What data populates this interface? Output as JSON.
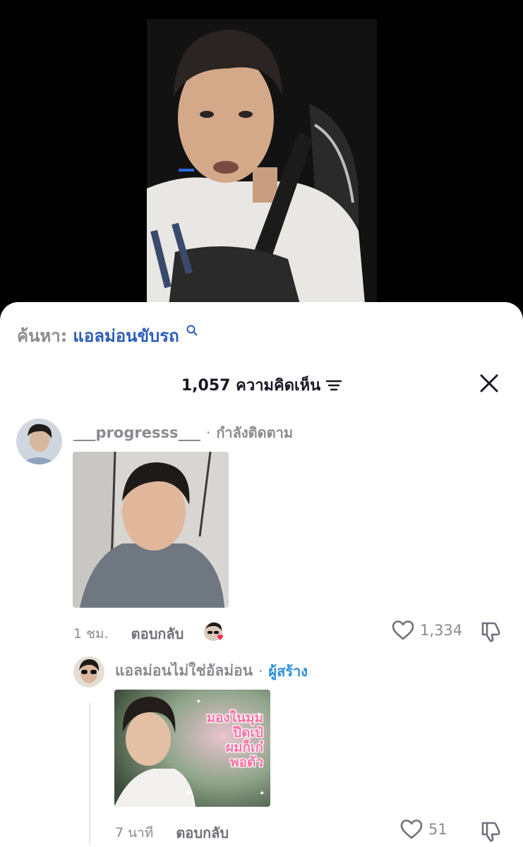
{
  "search": {
    "prefix": "ค้นหา:",
    "term": "แอลม่อนขับรถ"
  },
  "comments_header": {
    "count_label": "1,057 ความคิดเห็น"
  },
  "comments": [
    {
      "username": "___progresss___",
      "separator": "·",
      "relation": "กำลังติดตาม",
      "time": "1 ชม.",
      "reply_label": "ตอบกลับ",
      "likes": "1,334"
    }
  ],
  "replies": [
    {
      "username": "แอลม่อนไม่ใช่อัลม่อน",
      "separator": "·",
      "badge": "ผู้สร้าง",
      "image_caption": [
        "มองในมุม",
        "ปีดเป๋",
        "ผมก็เก๋",
        "พอตัว"
      ],
      "time": "7 นาที",
      "reply_label": "ตอบกลับ",
      "likes": "51"
    }
  ],
  "colors": {
    "accent_search": "#2b5db9",
    "creator_badge": "#2b8fd9",
    "like_heart": "#fe2c55"
  }
}
